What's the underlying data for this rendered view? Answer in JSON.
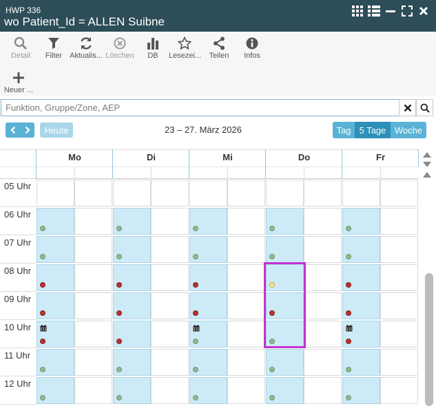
{
  "header": {
    "subtitle": "HWP 336",
    "title": "wo Patient_Id = ALLEN Suibne"
  },
  "toolbar": {
    "detail": "Detail",
    "filter": "Filter",
    "aktualisieren": "Aktualis...",
    "loeschen": "Löschen",
    "db": "DB",
    "lesezeichen": "Lesezei...",
    "teilen": "Teilen",
    "infos": "Infos",
    "neuer": "Neuer ..."
  },
  "search": {
    "placeholder": "Funktion, Gruppe/Zone, AEP",
    "value": ""
  },
  "nav": {
    "today": "Heute",
    "range": "23 – 27. März 2026",
    "views": [
      "Tag",
      "5 Tage",
      "Woche"
    ],
    "active_view": "5 Tage"
  },
  "calendar": {
    "days": [
      "Mo",
      "Di",
      "Mi",
      "Do",
      "Fr"
    ],
    "hours": [
      "05 Uhr",
      "06 Uhr",
      "07 Uhr",
      "08 Uhr",
      "09 Uhr",
      "10 Uhr",
      "11 Uhr",
      "12 Uhr"
    ],
    "status_colors": {
      "green": "#93b793",
      "red": "#b83232",
      "yellow": "#f4e48a",
      "booked": "#cdeaf7"
    },
    "slots": [
      [
        "",
        "",
        "",
        "",
        ""
      ],
      [
        "green",
        "green",
        "green",
        "green",
        "green"
      ],
      [
        "green",
        "green",
        "green",
        "green",
        "green"
      ],
      [
        "red",
        "red",
        "red",
        "yellow",
        "red"
      ],
      [
        "red",
        "red",
        "red",
        "red",
        "red"
      ],
      [
        "red",
        "red",
        "green",
        "green",
        "red"
      ],
      [
        "green",
        "green",
        "green",
        "green",
        "green"
      ],
      [
        "green",
        "green",
        "green",
        "green",
        "green"
      ]
    ],
    "calendar_icons_at_10": [
      "Mo",
      "Mi",
      "Fr"
    ],
    "highlight_color": "#c233d1"
  }
}
